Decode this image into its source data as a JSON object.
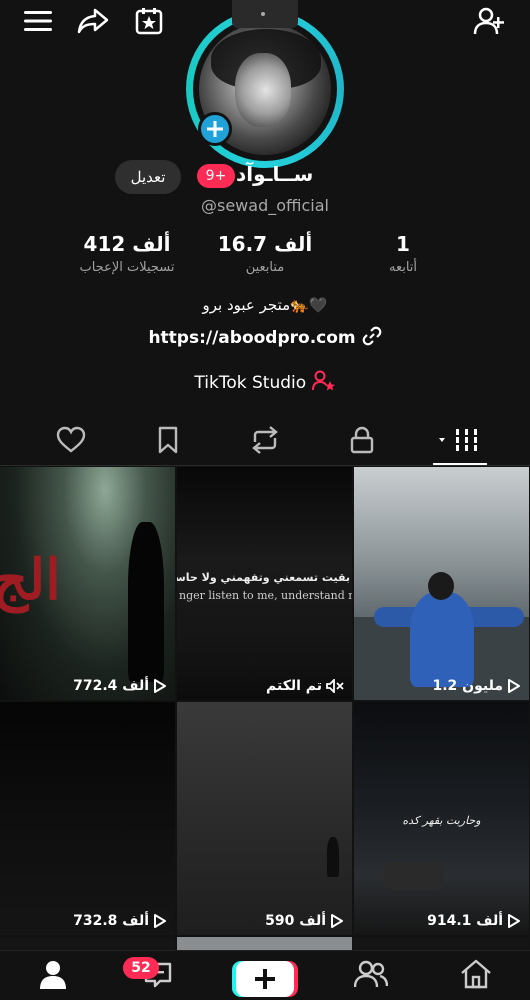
{
  "profile": {
    "display_name": "ســاـوآد",
    "username": "@sewad_official",
    "edit_label": "تعديل",
    "notification_badge": "9+",
    "stats": {
      "likes": {
        "value": "412 ألف",
        "label": "تسجيلات الإعجاب"
      },
      "followers": {
        "value": "16.7 ألف",
        "label": "متابعين"
      },
      "following": {
        "value": "1",
        "label": "أتابعه"
      }
    },
    "bio": "متجر عبود برو🐅🖤",
    "link": "https://aboodpro.com",
    "studio_label": "TikTok Studio"
  },
  "tabs": [
    {
      "name": "videos",
      "icon": "grid-icon",
      "active": true
    },
    {
      "name": "private",
      "icon": "lock-icon"
    },
    {
      "name": "reposts",
      "icon": "repost-icon"
    },
    {
      "name": "favorites",
      "icon": "bookmark-icon"
    },
    {
      "name": "liked",
      "icon": "heart-icon"
    }
  ],
  "videos": [
    {
      "views": "772.4 ألف"
    },
    {
      "views": "تم الكتم",
      "overlay_ar": "بقيت تسمعني وتفهمني ولا حاسن بي",
      "overlay_en": "nger listen to me, understand me, or"
    },
    {
      "views": "1.2 مليون"
    },
    {
      "views": "732.8 ألف"
    },
    {
      "views": "590 ألف"
    },
    {
      "views": "914.1 ألف",
      "overlay": "وحاربت بقهر كده"
    }
  ],
  "video_overlay_c1": "الج",
  "bottom_nav": {
    "messages_badge": "52"
  },
  "colors": {
    "accent_pink": "#fe2c55",
    "accent_cyan": "#25f4ee",
    "ring": "#25d0dc",
    "background": "#121212"
  }
}
